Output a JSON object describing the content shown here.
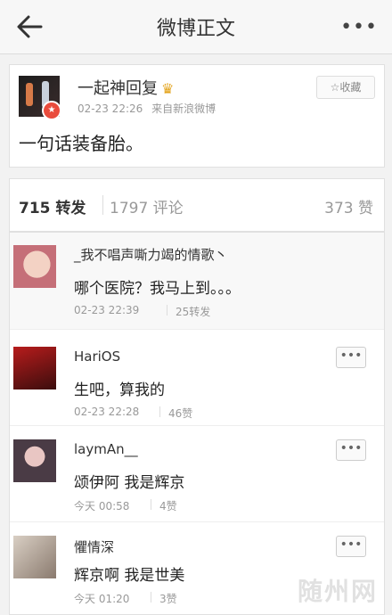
{
  "header": {
    "title": "微博正文",
    "more": "•••"
  },
  "post": {
    "username": "一起神回复",
    "crown_icon": "crown-icon",
    "date": "02-23 22:26",
    "source": "来自新浪微博",
    "favorite_label": "☆收藏",
    "content": "一句话装备胎。"
  },
  "counts": {
    "repost": "715 转发",
    "comment": "1797 评论",
    "like": "373 赞"
  },
  "comments": [
    {
      "name": "_我不唱声嘶力竭的情歌丶",
      "text": "哪个医院？我马上到。。。",
      "time": "02-23 22:39",
      "count": "25转发"
    },
    {
      "name": "HariOS",
      "text": "生吧，算我的",
      "time": "02-23 22:28",
      "count": "46赞",
      "more": "•••"
    },
    {
      "name": "laymAn__",
      "text": "颂伊阿 我是辉京",
      "time": "今天 00:58",
      "count": "4赞",
      "more": "•••"
    },
    {
      "name": "懼情深",
      "text": "辉京啊 我是世美",
      "time": "今天 01:20",
      "count": "3赞",
      "more": "•••"
    }
  ],
  "watermark": "随州网",
  "colors": {
    "accent": "#e94b3c",
    "muted": "#999999",
    "background": "#f2f2f2"
  }
}
